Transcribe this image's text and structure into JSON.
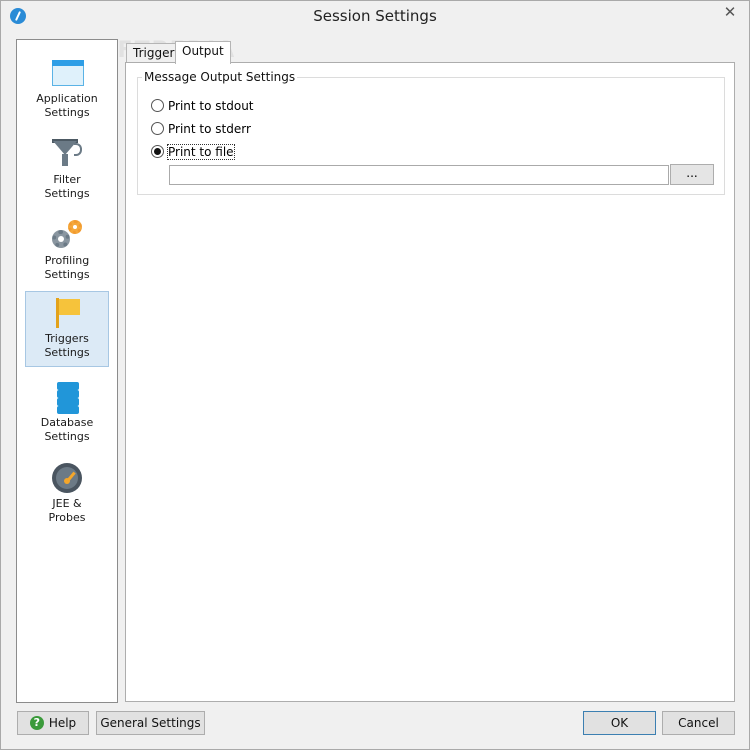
{
  "window": {
    "title": "Session Settings",
    "close_glyph": "✕"
  },
  "sidebar": {
    "items": [
      {
        "label": "Application\nSettings",
        "icon": "application-window-icon"
      },
      {
        "label": "Filter\nSettings",
        "icon": "funnel-icon"
      },
      {
        "label": "Profiling\nSettings",
        "icon": "gears-icon"
      },
      {
        "label": "Triggers\nSettings",
        "icon": "flag-icon",
        "selected": true
      },
      {
        "label": "Database\nSettings",
        "icon": "database-icon"
      },
      {
        "label": "JEE &\nProbes",
        "icon": "gauge-icon"
      }
    ]
  },
  "tabs": [
    {
      "label": "Triggers",
      "active": false
    },
    {
      "label": "Output",
      "active": true
    }
  ],
  "output": {
    "group_title": "Message Output Settings",
    "options": [
      {
        "label": "Print to stdout",
        "checked": false
      },
      {
        "label": "Print to stderr",
        "checked": false
      },
      {
        "label": "Print to file",
        "checked": true
      }
    ],
    "file_path": "",
    "browse_label": "..."
  },
  "buttons": {
    "help": "Help",
    "help_icon_glyph": "?",
    "general": "General Settings",
    "ok": "OK",
    "cancel": "Cancel"
  },
  "watermark": "SOFTPEDIA"
}
